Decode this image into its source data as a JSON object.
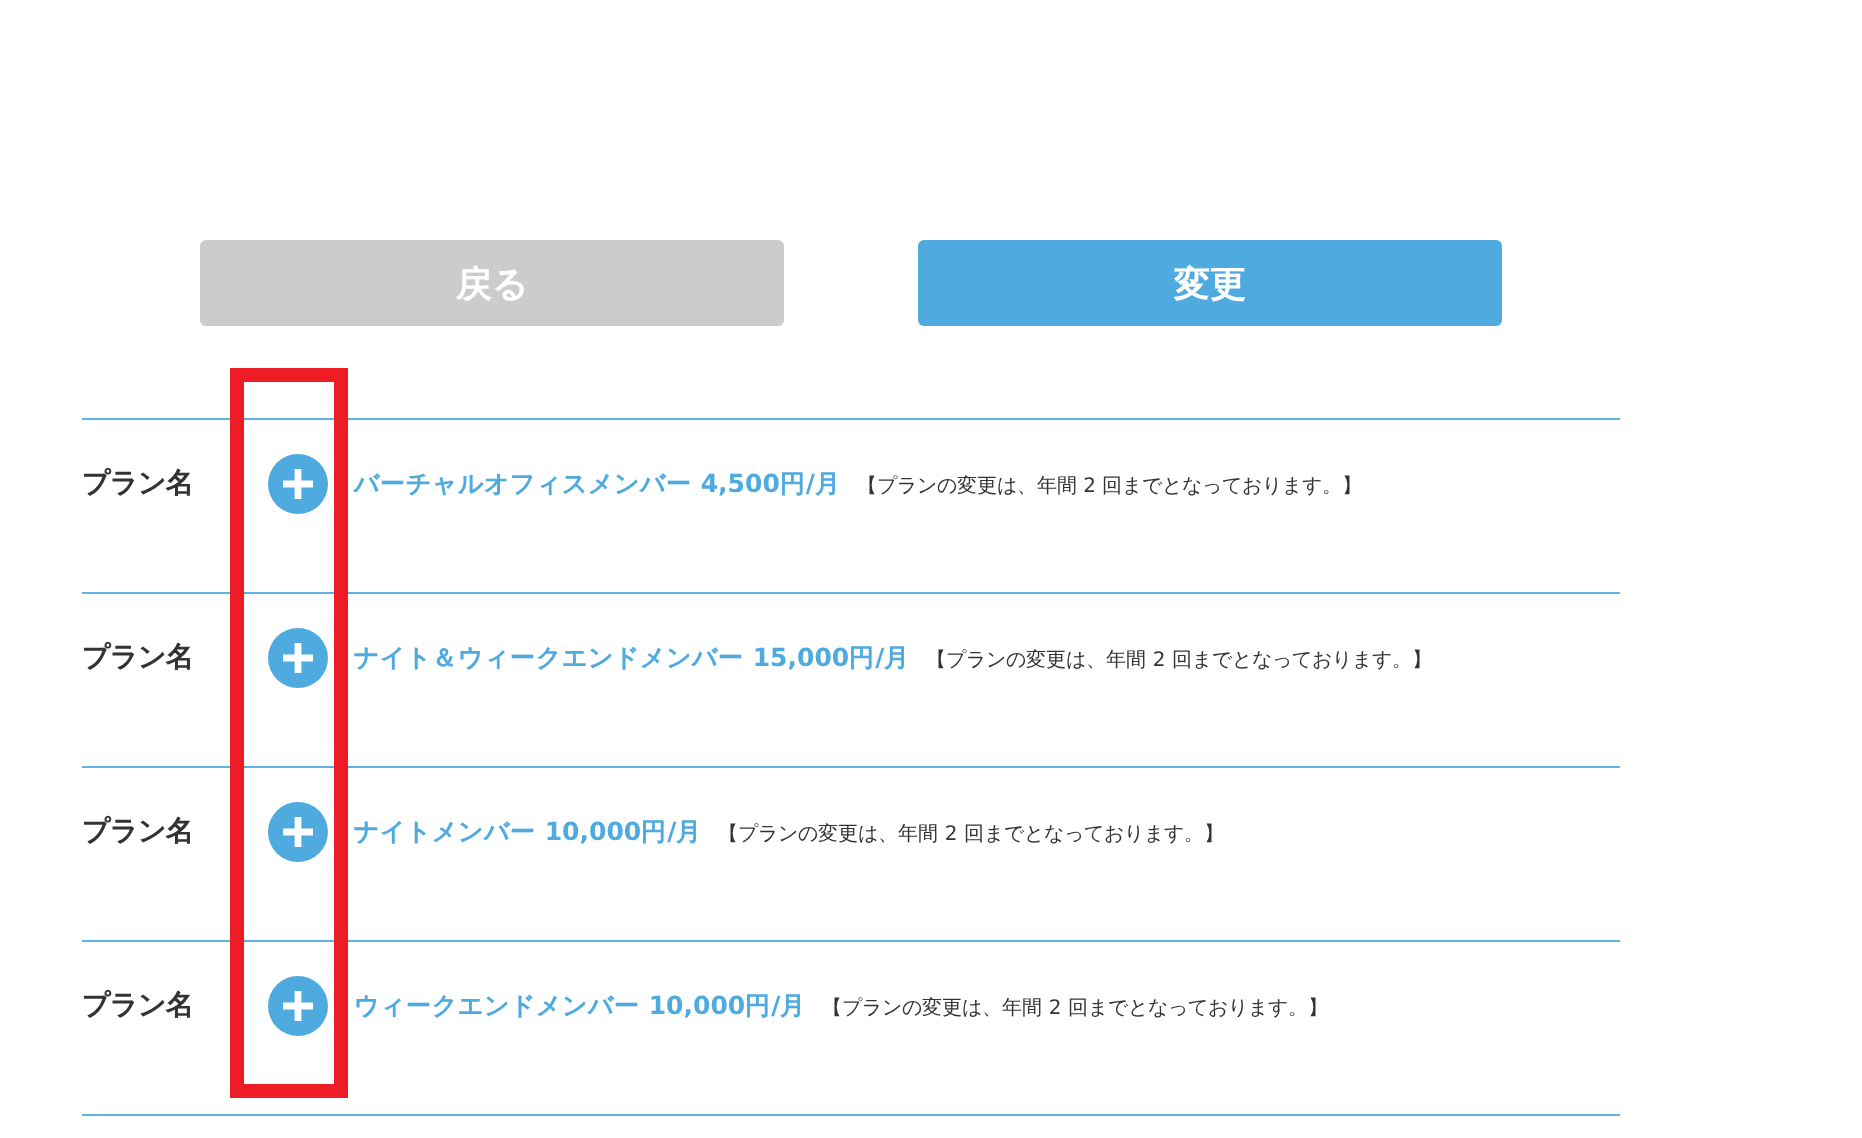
{
  "buttons": [
    {
      "label": "戻る",
      "kind": "secondary"
    },
    {
      "label": "変更",
      "kind": "primary"
    }
  ],
  "plans": [
    {
      "label": "プラン名",
      "name": "バーチャルオフィスメンバー 4,500円/月",
      "note": "【プランの変更は、年間 2 回までとなっております。】"
    },
    {
      "label": "プラン名",
      "name": "ナイト＆ウィークエンドメンバー 15,000円/月",
      "note": "【プランの変更は、年間 2 回までとなっております。】"
    },
    {
      "label": "プラン名",
      "name": "ナイトメンバー 10,000円/月",
      "note": "【プランの変更は、年間 2 回までとなっております。】"
    },
    {
      "label": "プラン名",
      "name": "ウィークエンドメンバー 10,000円/月",
      "note": "【プランの変更は、年間 2 回までとなっております。】"
    }
  ]
}
